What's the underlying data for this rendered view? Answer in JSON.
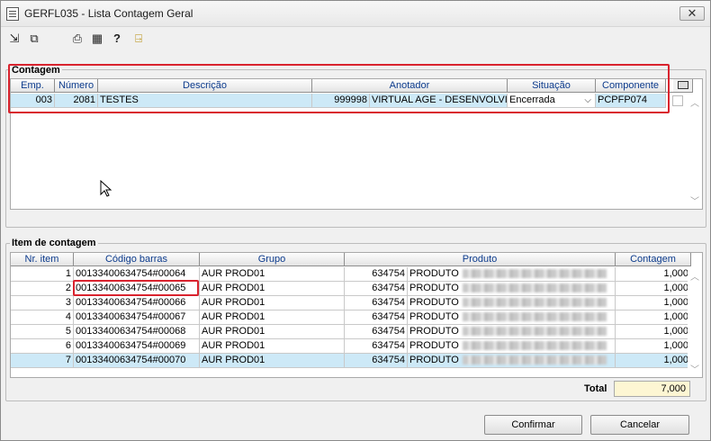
{
  "window": {
    "title": "GERFL035 - Lista Contagem Geral",
    "close_label": "✕"
  },
  "toolbar": {
    "icons": [
      "import-icon",
      "copy-icon",
      "print-icon",
      "calendar-icon",
      "help-icon",
      "exit-icon"
    ]
  },
  "contagem": {
    "title": "Contagem",
    "columns": [
      "Emp.",
      "Número",
      "Descrição",
      "Anotador",
      "Situação",
      "Componente"
    ],
    "rows": [
      {
        "emp": "003",
        "numero": "2081",
        "descricao": "TESTES",
        "anotador_code": "999998",
        "anotador_name": "VIRTUAL AGE - DESENVOLVIM",
        "situacao": "Encerrada",
        "componente": "PCPFP074"
      }
    ]
  },
  "itens": {
    "title": "Item de contagem",
    "columns": [
      "Nr. item",
      "Código barras",
      "Grupo",
      "Produto",
      "Contagem"
    ],
    "rows": [
      {
        "nr": "1",
        "codigo": "00133400634754#00064",
        "grupo": "AUR PROD01",
        "produto_code": "634754",
        "produto": "PRODUTO",
        "contagem": "1,000"
      },
      {
        "nr": "2",
        "codigo": "00133400634754#00065",
        "grupo": "AUR PROD01",
        "produto_code": "634754",
        "produto": "PRODUTO",
        "contagem": "1,000"
      },
      {
        "nr": "3",
        "codigo": "00133400634754#00066",
        "grupo": "AUR PROD01",
        "produto_code": "634754",
        "produto": "PRODUTO",
        "contagem": "1,000"
      },
      {
        "nr": "4",
        "codigo": "00133400634754#00067",
        "grupo": "AUR PROD01",
        "produto_code": "634754",
        "produto": "PRODUTO",
        "contagem": "1,000"
      },
      {
        "nr": "5",
        "codigo": "00133400634754#00068",
        "grupo": "AUR PROD01",
        "produto_code": "634754",
        "produto": "PRODUTO",
        "contagem": "1,000"
      },
      {
        "nr": "6",
        "codigo": "00133400634754#00069",
        "grupo": "AUR PROD01",
        "produto_code": "634754",
        "produto": "PRODUTO",
        "contagem": "1,000"
      },
      {
        "nr": "7",
        "codigo": "00133400634754#00070",
        "grupo": "AUR PROD01",
        "produto_code": "634754",
        "produto": "PRODUTO",
        "contagem": "1,000"
      }
    ],
    "total_label": "Total",
    "total_value": "7,000"
  },
  "buttons": {
    "confirm": "Confirmar",
    "cancel": "Cancelar"
  },
  "colors": {
    "selected_row": "#cde9f7",
    "highlight": "#d9232e",
    "header_text": "#0b3a8c",
    "total_field": "#fdf6d3"
  }
}
